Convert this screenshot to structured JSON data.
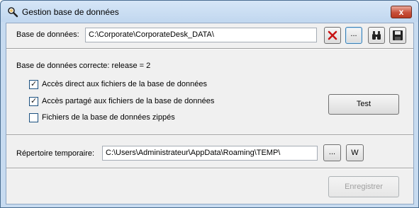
{
  "window": {
    "title": "Gestion base de données",
    "close_label": "x"
  },
  "database": {
    "label": "Base de données:",
    "path": "C:\\Corporate\\CorporateDesk_DATA\\",
    "browse_label": "..."
  },
  "status": {
    "text": "Base de données correcte: release = 2"
  },
  "options": [
    {
      "label": "Accès direct aux fichiers de la base de données",
      "checked": true
    },
    {
      "label": "Accès partagé aux fichiers de la base de données",
      "checked": true
    },
    {
      "label": "Fichiers de la base de données zippés",
      "checked": false
    }
  ],
  "test_button": {
    "label": "Test"
  },
  "temp": {
    "label": "Répertoire temporaire:",
    "path": "C:\\Users\\Administrateur\\AppData\\Roaming\\TEMP\\",
    "browse_label": "...",
    "w_label": "W"
  },
  "save_button": {
    "label": "Enregistrer"
  }
}
